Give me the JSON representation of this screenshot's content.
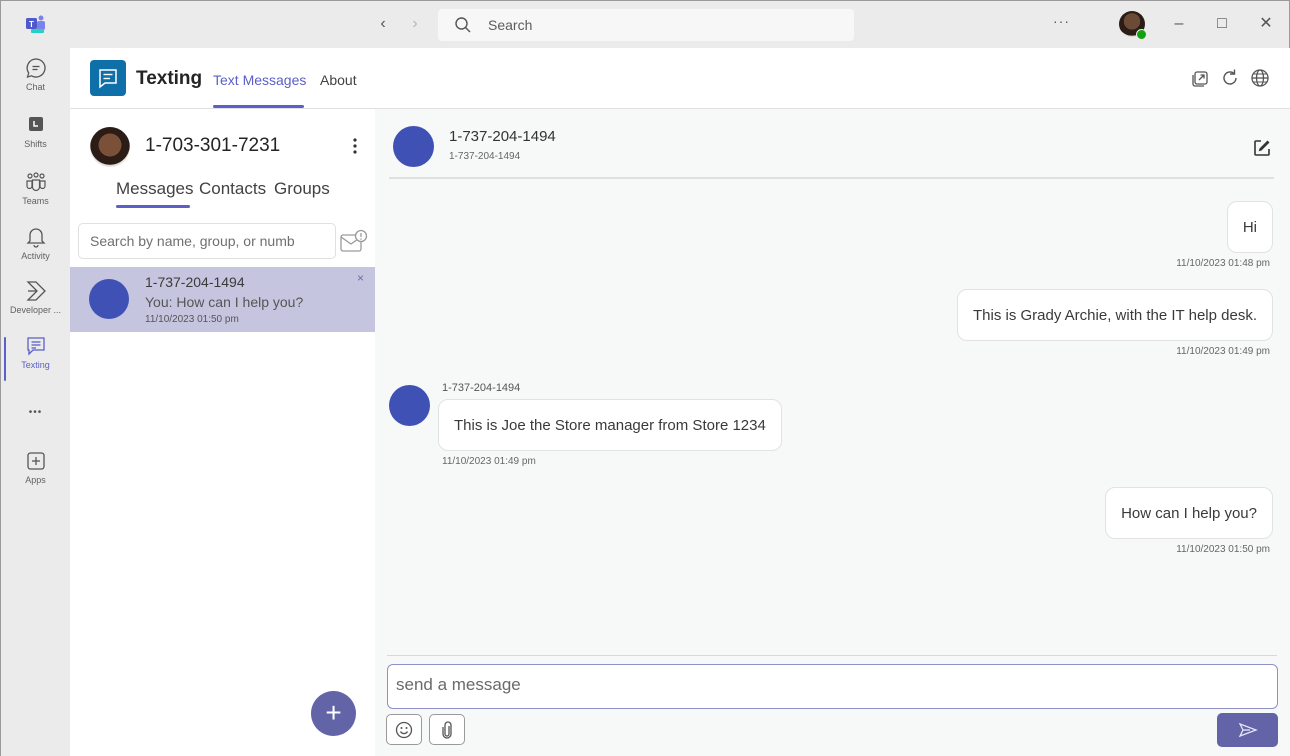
{
  "titlebar": {
    "search_label": "Search",
    "more_label": "···",
    "back_glyph": "‹",
    "forward_glyph": "›",
    "minimize_glyph": "–",
    "maximize_glyph": "□",
    "close_glyph": "✕"
  },
  "rail": {
    "items": [
      {
        "label": "Chat",
        "icon": "chat-icon"
      },
      {
        "label": "Shifts",
        "icon": "shifts-icon"
      },
      {
        "label": "Teams",
        "icon": "teams-icon"
      },
      {
        "label": "Activity",
        "icon": "bell-icon"
      },
      {
        "label": "Developer ...",
        "icon": "developer-portal-icon"
      },
      {
        "label": "Texting",
        "icon": "texting-icon",
        "active": true
      },
      {
        "label": "•••",
        "icon": "more-apps-icon"
      },
      {
        "label": "Apps",
        "icon": "apps-add-icon"
      }
    ]
  },
  "app_header": {
    "title": "Texting",
    "tabs": [
      {
        "label": "Text Messages",
        "active": true
      },
      {
        "label": "About",
        "active": false
      }
    ],
    "icons": [
      "popout-icon",
      "refresh-icon",
      "globe-icon"
    ]
  },
  "left_pane": {
    "my_number": "1-703-301-7231",
    "tabs": [
      {
        "label": "Messages",
        "active": true
      },
      {
        "label": "Contacts",
        "active": false
      },
      {
        "label": "Groups",
        "active": false
      }
    ],
    "search_placeholder": "Search by name, group, or numb",
    "conversations": [
      {
        "name": "1-737-204-1494",
        "preview": "You: How can I help you?",
        "time": "11/10/2023 01:50 pm",
        "close_glyph": "×",
        "selected": true
      }
    ],
    "fab_glyph": "+"
  },
  "chat": {
    "title": "1-737-204-1494",
    "subtitle": "1-737-204-1494",
    "messages": [
      {
        "direction": "outgoing",
        "text": "Hi",
        "time": "11/10/2023 01:48 pm"
      },
      {
        "direction": "outgoing",
        "text": "This is Grady Archie, with the IT help desk.",
        "time": "11/10/2023 01:49 pm"
      },
      {
        "direction": "incoming",
        "sender": "1-737-204-1494",
        "text": "This is Joe the Store manager from Store 1234",
        "time": "11/10/2023 01:49 pm"
      },
      {
        "direction": "outgoing",
        "text": "How can I help you?",
        "time": "11/10/2023 01:50 pm"
      }
    ],
    "compose_placeholder": "send a message",
    "compose_value": ""
  },
  "colors": {
    "accent": "#5b5fc7",
    "button": "#6264a7",
    "avatar": "#3f51b5",
    "selected_row": "#c5c5e0",
    "app_logo": "#0f6fa8"
  }
}
